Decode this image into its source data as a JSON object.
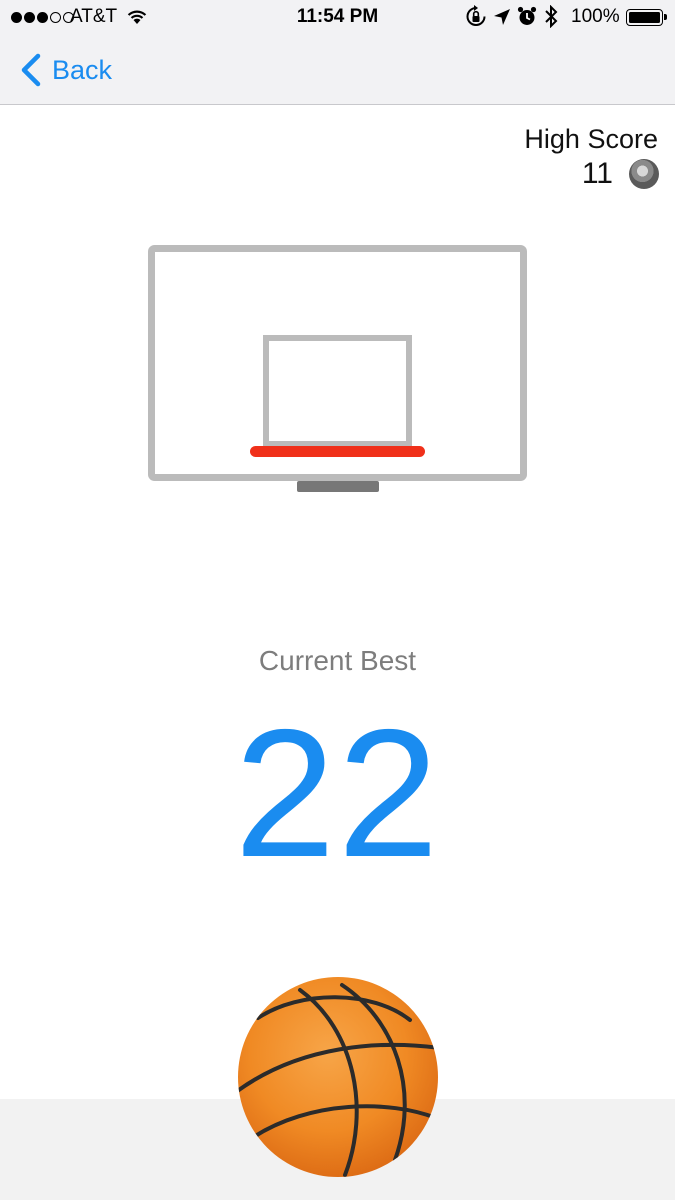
{
  "status_bar": {
    "carrier": "AT&T",
    "time": "11:54 PM",
    "battery": "100%",
    "signal_bars_filled": 3,
    "signal_bars_total": 5
  },
  "nav": {
    "back_label": "Back"
  },
  "high_score": {
    "title": "High Score",
    "value": "11"
  },
  "current_best": {
    "label": "Current Best",
    "value": "22"
  },
  "colors": {
    "accent": "#1a8cf0",
    "rim": "#f0301a",
    "backboard": "#bbbbbb",
    "ball": "#f08a24",
    "floor": "#f2f2f2"
  },
  "icons": [
    "wifi-icon",
    "rotation-lock-icon",
    "location-icon",
    "alarm-icon",
    "bluetooth-icon",
    "battery-icon",
    "back-chevron-icon",
    "avatar",
    "basketball"
  ]
}
